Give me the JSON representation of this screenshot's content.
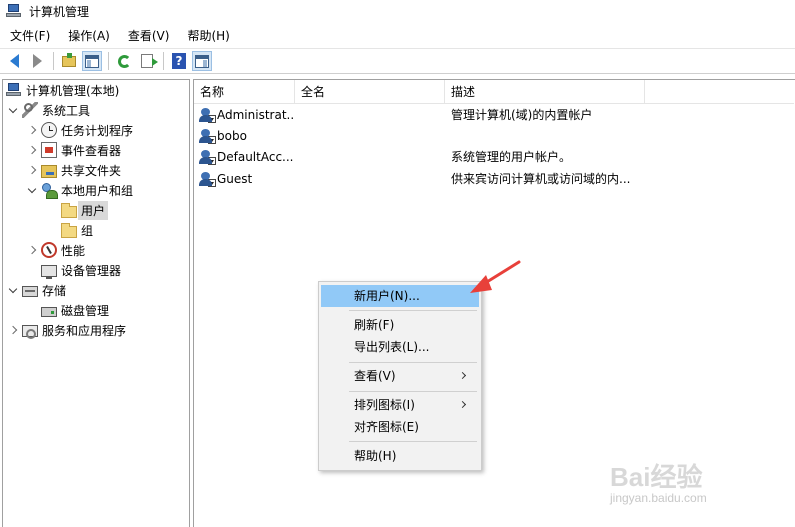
{
  "window": {
    "title": "计算机管理"
  },
  "menubar": [
    {
      "label": "文件(F)"
    },
    {
      "label": "操作(A)"
    },
    {
      "label": "查看(V)"
    },
    {
      "label": "帮助(H)"
    }
  ],
  "toolbar": {
    "buttons": [
      {
        "icon": "back-arrow-icon"
      },
      {
        "icon": "forward-arrow-icon"
      },
      {
        "icon": "up-folder-icon"
      },
      {
        "icon": "show-hide-console-tree-icon"
      },
      {
        "icon": "refresh-icon"
      },
      {
        "icon": "export-list-icon"
      },
      {
        "icon": "help-icon"
      },
      {
        "icon": "show-hide-action-pane-icon"
      }
    ]
  },
  "tree": {
    "items": [
      {
        "label": "计算机管理(本地)",
        "icon": "computer-icon",
        "expander": "none"
      },
      {
        "label": "系统工具",
        "icon": "tools-icon",
        "expander": "expanded"
      },
      {
        "label": "任务计划程序",
        "icon": "task-scheduler-icon",
        "expander": "collapsed"
      },
      {
        "label": "事件查看器",
        "icon": "event-viewer-icon",
        "expander": "collapsed"
      },
      {
        "label": "共享文件夹",
        "icon": "shared-folder-icon",
        "expander": "collapsed"
      },
      {
        "label": "本地用户和组",
        "icon": "local-users-groups-icon",
        "expander": "expanded"
      },
      {
        "label": "用户",
        "icon": "folder-icon",
        "expander": "none",
        "selected": true
      },
      {
        "label": "组",
        "icon": "folder-icon",
        "expander": "none"
      },
      {
        "label": "性能",
        "icon": "performance-icon",
        "expander": "collapsed"
      },
      {
        "label": "设备管理器",
        "icon": "device-manager-icon",
        "expander": "none"
      },
      {
        "label": "存储",
        "icon": "storage-icon",
        "expander": "expanded"
      },
      {
        "label": "磁盘管理",
        "icon": "disk-management-icon",
        "expander": "none"
      },
      {
        "label": "服务和应用程序",
        "icon": "services-icon",
        "expander": "collapsed"
      }
    ]
  },
  "list": {
    "columns": [
      "名称",
      "全名",
      "描述"
    ],
    "rows": [
      {
        "name": "Administrat...",
        "fullname": "",
        "description": "管理计算机(域)的内置帐户"
      },
      {
        "name": "bobo",
        "fullname": "",
        "description": ""
      },
      {
        "name": "DefaultAcc...",
        "fullname": "",
        "description": "系统管理的用户帐户。"
      },
      {
        "name": "Guest",
        "fullname": "",
        "description": "供来宾访问计算机或访问域的内..."
      }
    ]
  },
  "context_menu": {
    "items": [
      {
        "label": "新用户(N)...",
        "highlighted": true,
        "submenu": false
      },
      {
        "label": "刷新(F)",
        "submenu": false
      },
      {
        "label": "导出列表(L)...",
        "submenu": false
      },
      {
        "label": "查看(V)",
        "submenu": true
      },
      {
        "label": "排列图标(I)",
        "submenu": true
      },
      {
        "label": "对齐图标(E)",
        "submenu": false
      },
      {
        "label": "帮助(H)",
        "submenu": false
      }
    ]
  },
  "annotation": {
    "color": "#e8403a"
  },
  "watermark": {
    "main": "Bai经验",
    "sub": "jingyan.baidu.com"
  },
  "colors": {
    "highlight": "#91c9f7",
    "accent": "#2b7bd1"
  }
}
